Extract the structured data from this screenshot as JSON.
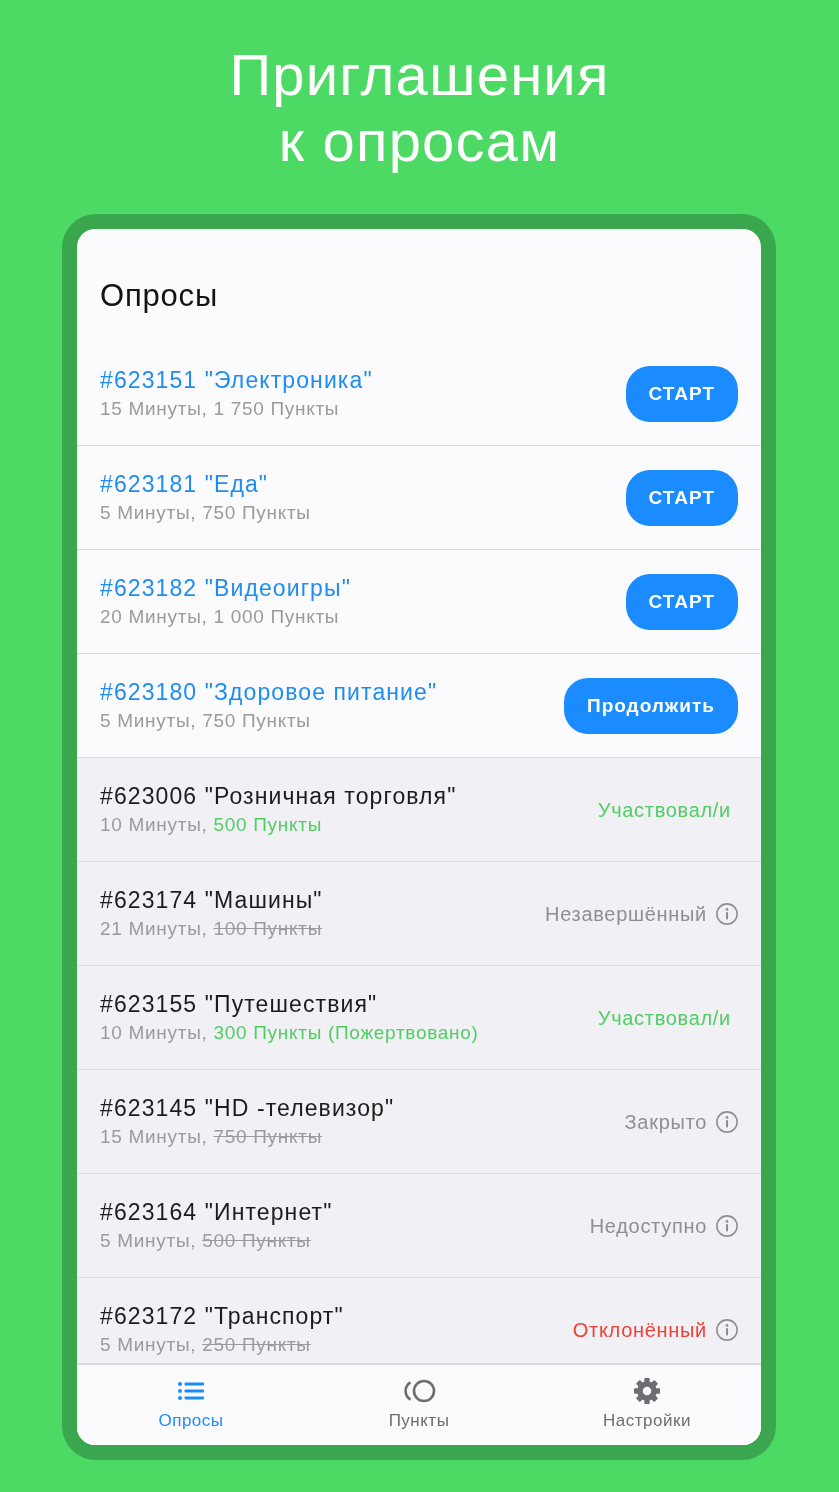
{
  "heading": {
    "title": "Приглашения\nк опросам"
  },
  "screen": {
    "title": "Опросы"
  },
  "surveys": [
    {
      "kind": "open",
      "title": "#623151 \"Электроника\"",
      "duration": "15 Минуты,",
      "points": "1 750 Пункты",
      "earned": false,
      "struck": false,
      "action": "СТАРТ"
    },
    {
      "kind": "open",
      "title": "#623181 \"Еда\"",
      "duration": "5 Минуты,",
      "points": "750 Пункты",
      "earned": false,
      "struck": false,
      "action": "СТАРТ"
    },
    {
      "kind": "open",
      "title": "#623182 \"Видеоигры\"",
      "duration": "20 Минуты,",
      "points": "1 000 Пункты",
      "earned": false,
      "struck": false,
      "action": "СТАРТ"
    },
    {
      "kind": "open",
      "title": "#623180 \"Здоровое питание\"",
      "duration": "5 Минуты,",
      "points": "750 Пункты",
      "earned": false,
      "struck": false,
      "action": "Продолжить"
    },
    {
      "kind": "closed",
      "title": "#623006 \"Розничная торговля\"",
      "duration": "10 Минуты,",
      "points": "500 Пункты",
      "earned": true,
      "struck": false,
      "status": "Участвовал/и",
      "color": "#4fcf62",
      "info": false
    },
    {
      "kind": "closed",
      "title": "#623174 \"Машины\"",
      "duration": "21 Минуты,",
      "points": "100 Пункты",
      "earned": false,
      "struck": true,
      "status": "Незавершённый",
      "color": "#8e8e93",
      "info": true
    },
    {
      "kind": "closed",
      "title": "#623155 \"Путешествия\"",
      "duration": "10 Минуты,",
      "points": "300 Пункты (Пожертвовано)",
      "earned": true,
      "struck": false,
      "status": "Участвовал/и",
      "color": "#4fcf62",
      "info": false
    },
    {
      "kind": "closed",
      "title": "#623145 \"HD -телевизор\"",
      "duration": "15 Минуты,",
      "points": "750 Пункты",
      "earned": false,
      "struck": true,
      "status": "Закрыто",
      "color": "#8e8e93",
      "info": true
    },
    {
      "kind": "closed",
      "title": "#623164 \"Интернет\"",
      "duration": "5 Минуты,",
      "points": "500 Пункты",
      "earned": false,
      "struck": true,
      "status": "Недоступно",
      "color": "#8e8e93",
      "info": true
    },
    {
      "kind": "closed",
      "title": "#623172 \"Транспорт\"",
      "duration": "5 Минуты,",
      "points": "250 Пункты",
      "earned": false,
      "struck": true,
      "status": "Отклонённый",
      "color": "#ef4237",
      "info": true
    }
  ],
  "tabs": [
    {
      "label": "Опросы",
      "selected": true
    },
    {
      "label": "Пункты",
      "selected": false
    },
    {
      "label": "Настройки",
      "selected": false
    }
  ]
}
